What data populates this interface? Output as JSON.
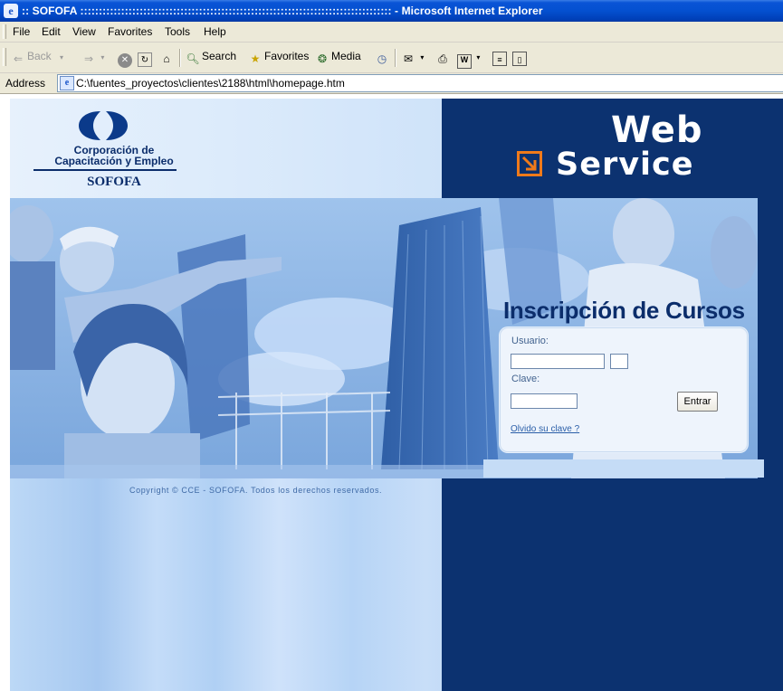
{
  "window": {
    "title": ":: SOFOFA :::::::::::::::::::::::::::::::::::::::::::::::::::::::::::::::::::::::::::::::::::: - Microsoft Internet Explorer"
  },
  "menu": [
    "File",
    "Edit",
    "View",
    "Favorites",
    "Tools",
    "Help"
  ],
  "toolbar": {
    "back": "Back",
    "search": "Search",
    "favorites": "Favorites",
    "media": "Media"
  },
  "address": {
    "label": "Address",
    "url": "C:\\fuentes_proyectos\\clientes\\2188\\html\\homepage.htm"
  },
  "page": {
    "logo": {
      "line1": "Corporación de",
      "line2": "Capacitación y Empleo",
      "line3": "SOFOFA"
    },
    "brand": {
      "web": "Web",
      "service": "Service",
      "accent_color": "#f07a1a"
    },
    "heading": "Inscripción de Cursos",
    "login": {
      "usuario_label": "Usuario:",
      "clave_label": "Clave:",
      "submit": "Entrar",
      "forgot": "Olvido su clave ?"
    },
    "copyright": "Copyright © CCE - SOFOFA. Todos los derechos reservados.",
    "colors": {
      "navy": "#0c3270",
      "light_blue": "#bcd8f6"
    }
  }
}
